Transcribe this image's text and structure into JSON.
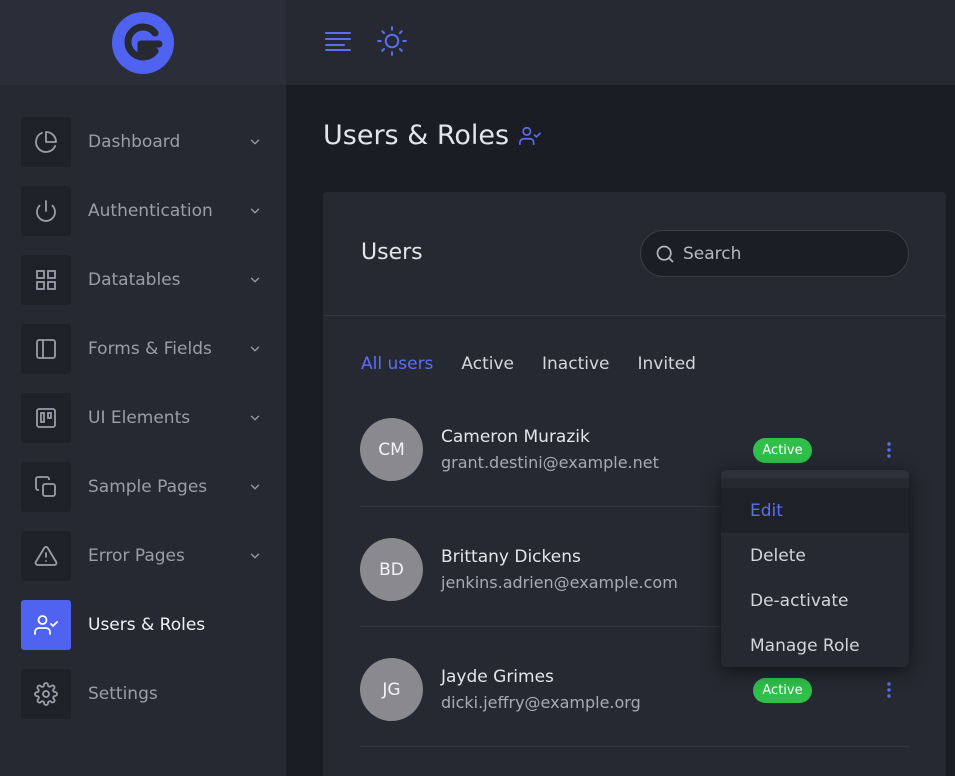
{
  "colors": {
    "accent": "#4f63f0",
    "active_badge": "#2fbf4a",
    "sidebar_bg": "#262932",
    "page_bg": "#1b1d24"
  },
  "topbar": {
    "menu_icon": "menu-lines-icon",
    "theme_icon": "sun-icon"
  },
  "sidebar": {
    "items": [
      {
        "label": "Dashboard",
        "icon": "pie-chart-icon",
        "has_chevron": true
      },
      {
        "label": "Authentication",
        "icon": "power-icon",
        "has_chevron": true
      },
      {
        "label": "Datatables",
        "icon": "grid-icon",
        "has_chevron": true
      },
      {
        "label": "Forms & Fields",
        "icon": "sidebar-layout-icon",
        "has_chevron": true
      },
      {
        "label": "UI Elements",
        "icon": "trello-icon",
        "has_chevron": true
      },
      {
        "label": "Sample Pages",
        "icon": "copy-icon",
        "has_chevron": true
      },
      {
        "label": "Error Pages",
        "icon": "alert-triangle-icon",
        "has_chevron": true
      },
      {
        "label": "Users & Roles",
        "icon": "user-check-icon",
        "has_chevron": false,
        "active": true
      },
      {
        "label": "Settings",
        "icon": "gear-icon",
        "has_chevron": false
      }
    ]
  },
  "page": {
    "title": "Users & Roles"
  },
  "card": {
    "title": "Users",
    "search": {
      "placeholder": "Search",
      "value": ""
    },
    "tabs": [
      {
        "label": "All users",
        "active": true
      },
      {
        "label": "Active"
      },
      {
        "label": "Inactive"
      },
      {
        "label": "Invited"
      }
    ],
    "users": [
      {
        "initials": "CM",
        "name": "Cameron Murazik",
        "email": "grant.destini@example.net",
        "status": "Active"
      },
      {
        "initials": "BD",
        "name": "Brittany Dickens",
        "email": "jenkins.adrien@example.com",
        "status": ""
      },
      {
        "initials": "JG",
        "name": "Jayde Grimes",
        "email": "dicki.jeffry@example.org",
        "status": "Active"
      }
    ]
  },
  "dropdown": {
    "items": [
      {
        "label": "Edit",
        "active": true
      },
      {
        "label": "Delete"
      },
      {
        "label": "De-activate"
      },
      {
        "label": "Manage Role"
      }
    ]
  }
}
